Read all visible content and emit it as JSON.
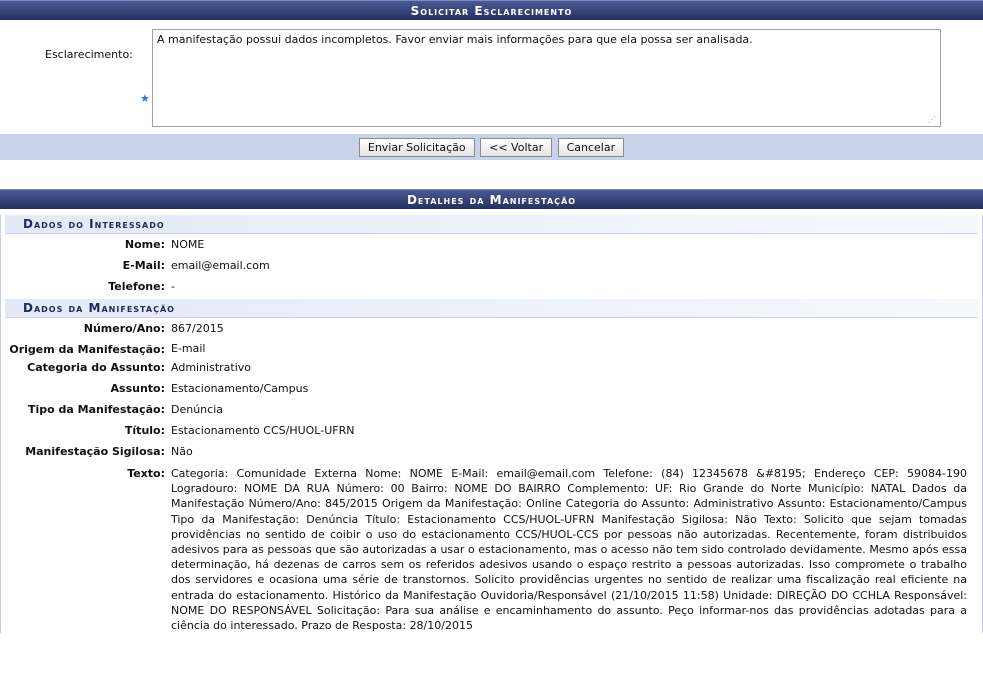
{
  "form": {
    "title": "Solicitar Esclarecimento",
    "field_label": "Esclarecimento:",
    "required_marker": "★",
    "textarea_value": "A manifestação possui dados incompletos. Favor enviar mais informações para que ela possa ser analisada.",
    "buttons": {
      "send": "Enviar Solicitação",
      "back": "<< Voltar",
      "cancel": "Cancelar"
    }
  },
  "details": {
    "title": "Detalhes da Manifestação",
    "interessado": {
      "section_title": "Dados do Interessado",
      "nome_label": "Nome:",
      "nome": "NOME",
      "email_label": "E-Mail:",
      "email": "email@email.com",
      "telefone_label": "Telefone:",
      "telefone": "-"
    },
    "manifestacao": {
      "section_title": "Dados da Manifestação",
      "numero_label": "Número/Ano:",
      "numero": "867/2015",
      "origem_label": "Origem da Manifestação:",
      "origem": "E-mail",
      "categoria_label": "Categoria do Assunto:",
      "categoria": "Administrativo",
      "assunto_label": "Assunto:",
      "assunto": "Estacionamento/Campus",
      "tipo_label": "Tipo da Manifestação:",
      "tipo": "Denúncia",
      "titulo_label": "Título:",
      "titulo": "Estacionamento CCS/HUOL-UFRN",
      "sigilosa_label": "Manifestação Sigilosa:",
      "sigilosa": "Não",
      "texto_label": "Texto:",
      "texto": "Categoria: Comunidade Externa Nome: NOME E-Mail: email@email.com Telefone: (84) 12345678 &#8195; Endereço CEP: 59084-190 Logradouro: NOME DA RUA Número: 00 Bairro: NOME DO BAIRRO Complemento: UF: Rio Grande do Norte Município: NATAL Dados da Manifestação Número/Ano: 845/2015 Origem da Manifestação: Online Categoria do Assunto: Administrativo Assunto: Estacionamento/Campus Tipo da Manifestação: Denúncia Título: Estacionamento CCS/HUOL-UFRN Manifestação Sigilosa: Não Texto: Solicito que sejam tomadas providências no sentido de coibir o uso do estacionamento CCS/HUOL-CCS por pessoas não autorizadas. Recentemente, foram distribuidos adesivos para as pessoas que são autorizadas a usar o estacionamento, mas o acesso não tem sido controlado devidamente. Mesmo após essa determinação, há dezenas de carros sem os referidos adesivos usando o espaço restrito a pessoas autorizadas. Isso compromete o trabalho dos servidores e ocasiona uma série de transtornos. Solicito providências urgentes no sentido de realizar uma fiscalização real eficiente na entrada do estacionamento. Histórico da Manifestação Ouvidoria/Responsável (21/10/2015 11:58) Unidade: DIREÇÃO DO CCHLA Responsável: NOME DO RESPONSÁVEL Solicitação: Para sua análise e encaminhamento do assunto. Peço informar-nos das providências adotadas para a ciência do interessado. Prazo de Resposta: 28/10/2015"
    }
  }
}
